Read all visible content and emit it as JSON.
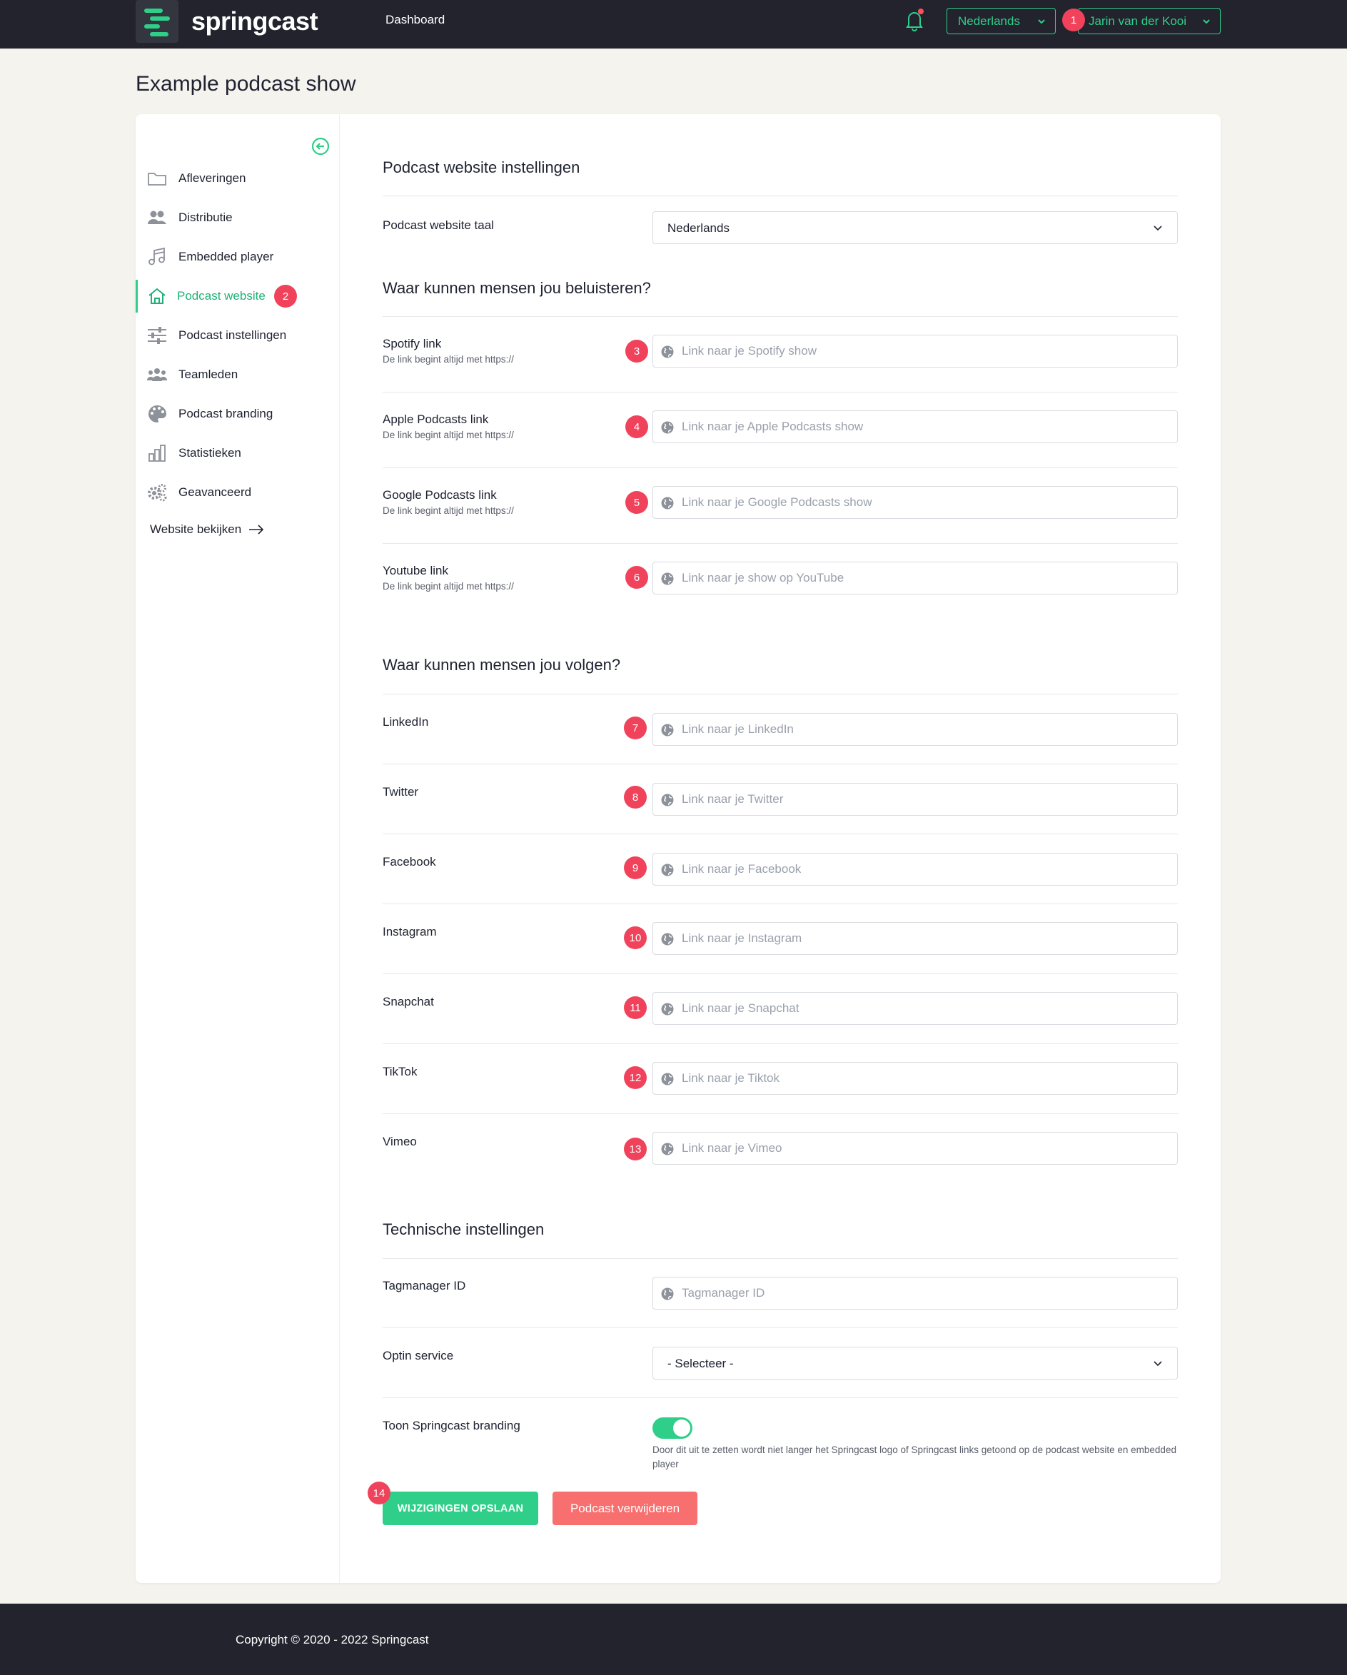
{
  "header": {
    "logo_text": "springcast",
    "nav_dashboard": "Dashboard",
    "language": "Nederlands",
    "user": "Jarin van der Kooi",
    "accent_color": "#2fcf8a"
  },
  "page": {
    "title": "Example podcast show"
  },
  "sidebar": {
    "items": [
      {
        "label": "Afleveringen",
        "icon": "folder-icon"
      },
      {
        "label": "Distributie",
        "icon": "users-icon"
      },
      {
        "label": "Embedded player",
        "icon": "music-note-icon"
      },
      {
        "label": "Podcast website",
        "icon": "home-icon",
        "active": true
      },
      {
        "label": "Podcast instellingen",
        "icon": "sliders-icon"
      },
      {
        "label": "Teamleden",
        "icon": "team-icon"
      },
      {
        "label": "Podcast branding",
        "icon": "palette-icon"
      },
      {
        "label": "Statistieken",
        "icon": "bar-chart-icon"
      },
      {
        "label": "Geavanceerd",
        "icon": "gears-icon"
      }
    ],
    "site_link": "Website bekijken"
  },
  "badges": [
    "1",
    "2",
    "3",
    "4",
    "5",
    "6",
    "7",
    "8",
    "9",
    "10",
    "11",
    "12",
    "13",
    "14"
  ],
  "general": {
    "title": "Podcast website instellingen",
    "lang_label": "Podcast website taal",
    "lang_value": "Nederlands"
  },
  "listen": {
    "title": "Waar kunnen mensen jou beluisteren?",
    "hint": "De link begint altijd met https://",
    "fields": [
      {
        "label": "Spotify link",
        "placeholder": "Link naar je Spotify show"
      },
      {
        "label": "Apple Podcasts link",
        "placeholder": "Link naar je Apple Podcasts show"
      },
      {
        "label": "Google Podcasts link",
        "placeholder": "Link naar je Google Podcasts show"
      },
      {
        "label": "Youtube link",
        "placeholder": "Link naar je show op YouTube"
      }
    ]
  },
  "follow": {
    "title": "Waar kunnen mensen jou volgen?",
    "fields": [
      {
        "label": "LinkedIn",
        "placeholder": "Link naar je LinkedIn"
      },
      {
        "label": "Twitter",
        "placeholder": "Link naar je Twitter"
      },
      {
        "label": "Facebook",
        "placeholder": "Link naar je Facebook"
      },
      {
        "label": "Instagram",
        "placeholder": "Link naar je Instagram"
      },
      {
        "label": "Snapchat",
        "placeholder": "Link naar je Snapchat"
      },
      {
        "label": "TikTok",
        "placeholder": "Link naar je Tiktok"
      },
      {
        "label": "Vimeo",
        "placeholder": "Link naar je Vimeo"
      }
    ]
  },
  "technical": {
    "title": "Technische instellingen",
    "tag_label": "Tagmanager ID",
    "tag_placeholder": "Tagmanager ID",
    "optin_label": "Optin service",
    "optin_value": "- Selecteer -",
    "branding_label": "Toon Springcast branding",
    "branding_on": true,
    "branding_desc": "Door dit uit te zetten wordt niet langer het Springcast logo of Springcast links getoond op de podcast website en embedded player"
  },
  "actions": {
    "save": "WIJZIGINGEN OPSLAAN",
    "delete": "Podcast verwijderen"
  },
  "footer": {
    "copyright": "Copyright © 2020 - 2022 Springcast"
  }
}
